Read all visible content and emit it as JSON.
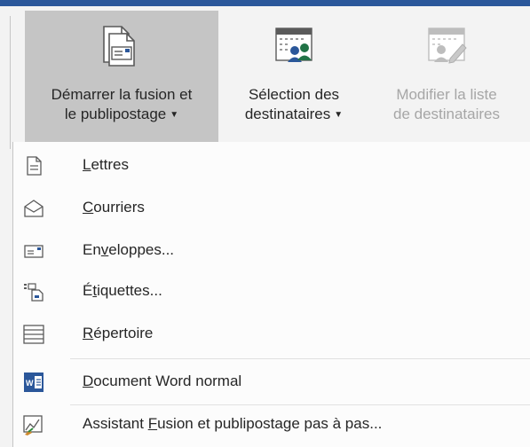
{
  "ribbon": {
    "start_merge": {
      "line1": "Démarrer la fusion et",
      "line2": "le publipostage"
    },
    "select_recipients": {
      "line1": "Sélection des",
      "line2": "destinataires"
    },
    "edit_list": {
      "line1": "Modifier la liste",
      "line2": "de destinataires"
    }
  },
  "menu": {
    "items": [
      {
        "before": "",
        "key": "L",
        "after": "ettres"
      },
      {
        "before": "",
        "key": "C",
        "after": "ourriers"
      },
      {
        "before": "En",
        "key": "v",
        "after": "eloppes..."
      },
      {
        "before": "É",
        "key": "t",
        "after": "iquettes..."
      },
      {
        "before": "",
        "key": "R",
        "after": "épertoire"
      },
      {
        "before": "",
        "key": "D",
        "after": "ocument Word normal"
      },
      {
        "before": "Assistant ",
        "key": "F",
        "after": "usion et publipostage pas à pas..."
      }
    ]
  },
  "colors": {
    "accent": "#2b579a",
    "active_button": "#c5c5c5",
    "disabled_text": "#a6a6a6"
  }
}
